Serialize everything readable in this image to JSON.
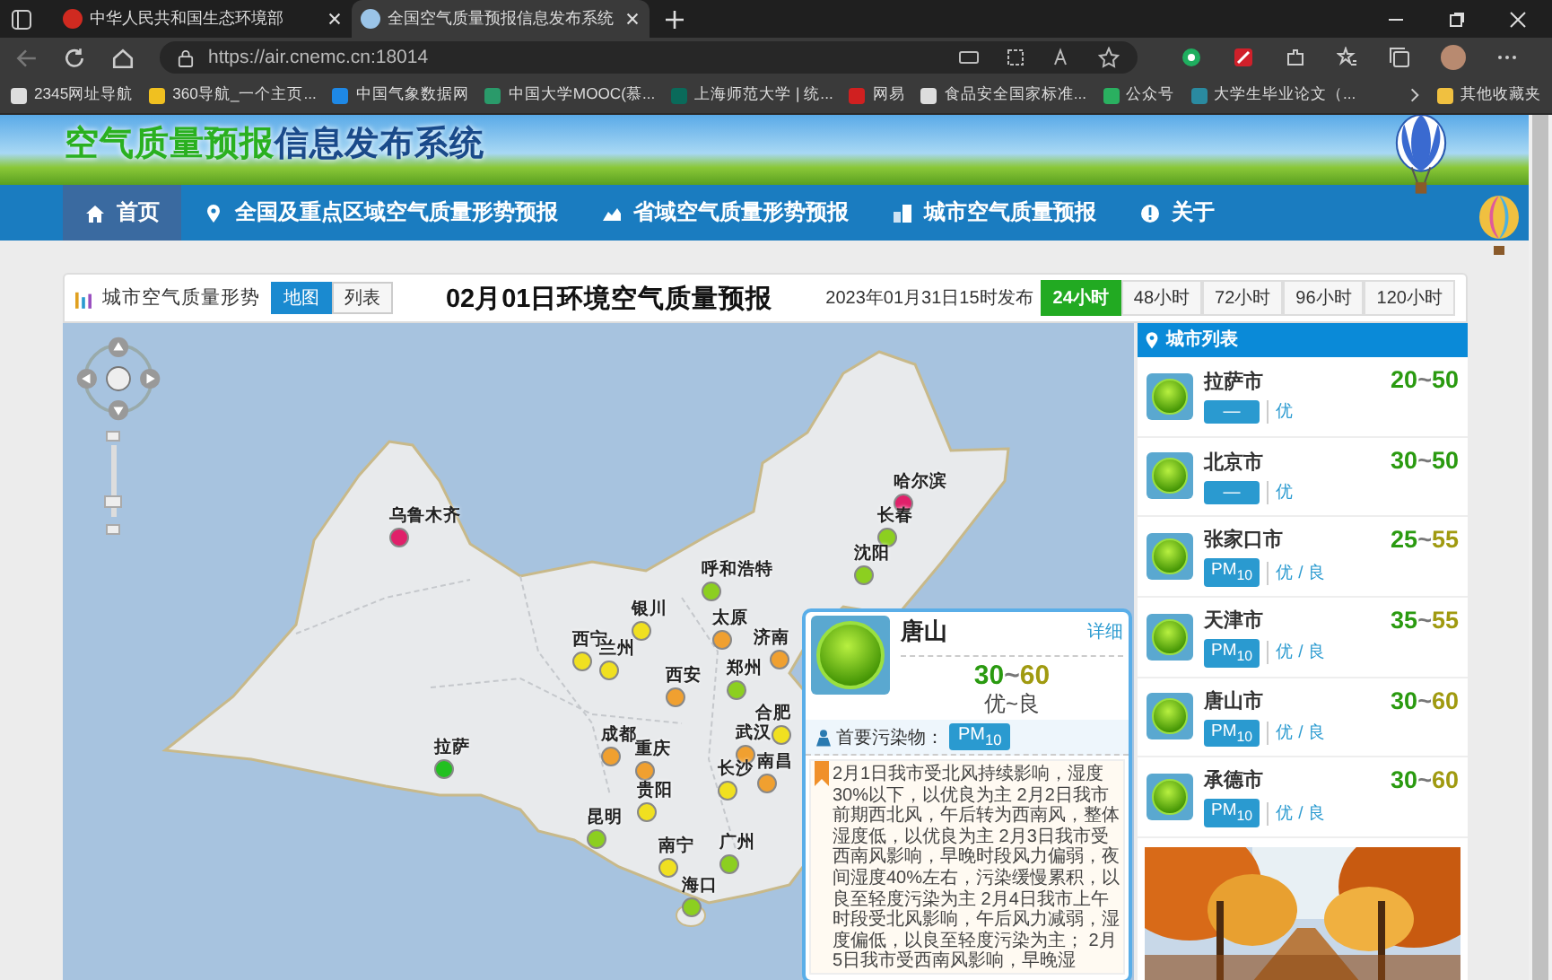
{
  "browser": {
    "tabs": [
      {
        "title": "中华人民共和国生态环境部",
        "selected": false
      },
      {
        "title": "全国空气质量预报信息发布系统",
        "selected": true
      }
    ],
    "url": "https://air.cnemc.cn:18014",
    "bookmarks": [
      "2345网址导航",
      "360导航_一个主页...",
      "中国气象数据网",
      "中国大学MOOC(慕...",
      "上海师范大学 | 统...",
      "网易",
      "食品安全国家标准...",
      "公众号",
      "大学生毕业论文（..."
    ],
    "other_bookmarks": "其他收藏夹"
  },
  "site": {
    "title_highlight": "空气质量预报",
    "title_rest": "信息发布系统"
  },
  "nav": [
    {
      "label": "首页",
      "kind": "home",
      "selected": true
    },
    {
      "label": "全国及重点区域空气质量形势预报",
      "kind": "pin",
      "selected": false
    },
    {
      "label": "省域空气质量形势预报",
      "kind": "chart",
      "selected": false
    },
    {
      "label": "城市空气质量预报",
      "kind": "building",
      "selected": false
    },
    {
      "label": "关于",
      "kind": "info",
      "selected": false
    }
  ],
  "panel": {
    "heading": "城市空气质量形势",
    "views": [
      {
        "label": "地图",
        "selected": true
      },
      {
        "label": "列表",
        "selected": false
      }
    ],
    "title": "02月01日环境空气质量预报",
    "published": "2023年01月31日15时发布",
    "periods": [
      {
        "label": "24小时",
        "selected": true
      },
      {
        "label": "48小时",
        "selected": false
      },
      {
        "label": "72小时",
        "selected": false
      },
      {
        "label": "96小时",
        "selected": false
      },
      {
        "label": "120小时",
        "selected": false
      }
    ]
  },
  "map": {
    "kind": "picture",
    "zoom": {
      "level": 0.15
    },
    "cities": [
      {
        "name": "乌鲁木齐",
        "color": "#e0206a"
      },
      {
        "name": "哈尔滨",
        "color": "#e0206a"
      },
      {
        "name": "长春",
        "color": "#8ccf20"
      },
      {
        "name": "沈阳",
        "color": "#8ccf20"
      },
      {
        "name": "呼和浩特",
        "color": "#8ccf20"
      },
      {
        "name": "银川",
        "color": "#f0e020"
      },
      {
        "name": "西宁",
        "color": "#f0e020"
      },
      {
        "name": "兰州",
        "color": "#f0e020"
      },
      {
        "name": "西安",
        "color": "#f0a030"
      },
      {
        "name": "太原",
        "color": "#f0a030"
      },
      {
        "name": "郑州",
        "color": "#8ccf20"
      },
      {
        "name": "济南",
        "color": "#f0a030"
      },
      {
        "name": "合肥",
        "color": "#f0e020"
      },
      {
        "name": "武汉",
        "color": "#f0a030"
      },
      {
        "name": "成都",
        "color": "#f0a030"
      },
      {
        "name": "重庆",
        "color": "#f0a030"
      },
      {
        "name": "拉萨",
        "color": "#22c020"
      },
      {
        "name": "长沙",
        "color": "#f0e020"
      },
      {
        "name": "南昌",
        "color": "#f0a030"
      },
      {
        "name": "贵阳",
        "color": "#f0e020"
      },
      {
        "name": "昆明",
        "color": "#8ccf20"
      },
      {
        "name": "南宁",
        "color": "#f0e020"
      },
      {
        "name": "广州",
        "color": "#8ccf20"
      },
      {
        "name": "海口",
        "color": "#8ccf20"
      }
    ]
  },
  "popup": {
    "city": "唐山",
    "detail_link": "详细",
    "range": [
      {
        "text": "30",
        "kind": "excellent"
      },
      {
        "text": "~",
        "kind": "separator"
      },
      {
        "text": "60",
        "kind": "good"
      }
    ],
    "grade": "优~良",
    "pollutant_label": "首要污染物：",
    "pollutant": "PM$_{10}$",
    "forecast": "2月1日我市受北风持续影响，湿度30%以下，以优良为主 2月2日我市前期西北风，午后转为西南风，整体湿度低，以优良为主 2月3日我市受西南风影响，早晚时段风力偏弱，夜间湿度40%左右，污染缓慢累积，以良至轻度污染为主 2月4日我市上午时段受北风影响，午后风力减弱，湿度偏低，以良至轻度污染为主； 2月5日我市受西南风影响，早晚湿"
  },
  "city_list": {
    "title": "城市列表",
    "cities": [
      {
        "name": "拉萨市",
        "pollutant": "—",
        "grade": "优",
        "range": [
          {
            "text": "20",
            "kind": "excellent"
          },
          {
            "text": "~",
            "kind": "separator"
          },
          {
            "text": "50",
            "kind": "excellent"
          }
        ]
      },
      {
        "name": "北京市",
        "pollutant": "—",
        "grade": "优",
        "range": [
          {
            "text": "30",
            "kind": "excellent"
          },
          {
            "text": "~",
            "kind": "separator"
          },
          {
            "text": "50",
            "kind": "excellent"
          }
        ]
      },
      {
        "name": "张家口市",
        "pollutant": "PM$_{10}$",
        "grade": "优 / 良",
        "range": [
          {
            "text": "25",
            "kind": "excellent"
          },
          {
            "text": "~",
            "kind": "separator"
          },
          {
            "text": "55",
            "kind": "good"
          }
        ]
      },
      {
        "name": "天津市",
        "pollutant": "PM$_{10}$",
        "grade": "优 / 良",
        "range": [
          {
            "text": "35",
            "kind": "excellent"
          },
          {
            "text": "~",
            "kind": "separator"
          },
          {
            "text": "55",
            "kind": "good"
          }
        ]
      },
      {
        "name": "唐山市",
        "pollutant": "PM$_{10}$",
        "grade": "优 / 良",
        "range": [
          {
            "text": "30",
            "kind": "excellent"
          },
          {
            "text": "~",
            "kind": "separator"
          },
          {
            "text": "60",
            "kind": "good"
          }
        ]
      },
      {
        "name": "承德市",
        "pollutant": "PM$_{10}$",
        "grade": "优 / 良",
        "range": [
          {
            "text": "30",
            "kind": "excellent"
          },
          {
            "text": "~",
            "kind": "separator"
          },
          {
            "text": "60",
            "kind": "good"
          }
        ]
      }
    ]
  }
}
